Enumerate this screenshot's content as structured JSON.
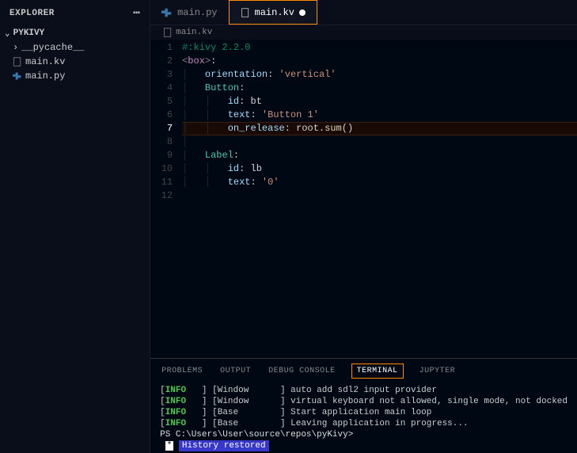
{
  "sidebar": {
    "title": "EXPLORER",
    "project": "PYKIVY",
    "items": [
      {
        "label": "__pycache__",
        "type": "folder"
      },
      {
        "label": "main.kv",
        "type": "file-kv"
      },
      {
        "label": "main.py",
        "type": "file-py"
      }
    ]
  },
  "tabs": [
    {
      "label": "main.py",
      "icon": "py",
      "active": false,
      "dirty": false
    },
    {
      "label": "main.kv",
      "icon": "kv",
      "active": true,
      "dirty": true
    }
  ],
  "breadcrumb": "main.kv",
  "code": {
    "activeLine": 7,
    "lines": [
      {
        "n": 1,
        "segments": [
          {
            "t": "#:kivy 2.2.0",
            "c": "tok-comment"
          }
        ]
      },
      {
        "n": 2,
        "segments": [
          {
            "t": "<",
            "c": "tok-ang"
          },
          {
            "t": "box",
            "c": "tok-tag"
          },
          {
            "t": ">",
            "c": "tok-ang"
          },
          {
            "t": ":",
            "c": "tok-paren"
          }
        ]
      },
      {
        "n": 3,
        "segments": [
          {
            "t": "│   ",
            "c": "indent-guide"
          },
          {
            "t": "orientation",
            "c": "tok-ident"
          },
          {
            "t": ": ",
            "c": "tok-paren"
          },
          {
            "t": "'vertical'",
            "c": "tok-string"
          }
        ]
      },
      {
        "n": 4,
        "segments": [
          {
            "t": "│   ",
            "c": "indent-guide"
          },
          {
            "t": "Button",
            "c": "tok-prop"
          },
          {
            "t": ":",
            "c": "tok-paren"
          }
        ]
      },
      {
        "n": 5,
        "segments": [
          {
            "t": "│   │   ",
            "c": "indent-guide"
          },
          {
            "t": "id",
            "c": "tok-ident"
          },
          {
            "t": ": bt",
            "c": "tok-paren"
          }
        ]
      },
      {
        "n": 6,
        "segments": [
          {
            "t": "│   │   ",
            "c": "indent-guide"
          },
          {
            "t": "text",
            "c": "tok-ident"
          },
          {
            "t": ": ",
            "c": "tok-paren"
          },
          {
            "t": "'Button 1'",
            "c": "tok-string"
          }
        ]
      },
      {
        "n": 7,
        "hl": true,
        "segments": [
          {
            "t": "│   │   ",
            "c": "indent-guide"
          },
          {
            "t": "on_release",
            "c": "tok-ident"
          },
          {
            "t": ": root.",
            "c": "tok-paren"
          },
          {
            "t": "sum",
            "c": "tok-func"
          },
          {
            "t": "()",
            "c": "tok-paren"
          }
        ]
      },
      {
        "n": 8,
        "segments": [
          {
            "t": "│",
            "c": "indent-guide"
          }
        ]
      },
      {
        "n": 9,
        "segments": [
          {
            "t": "│   ",
            "c": "indent-guide"
          },
          {
            "t": "Label",
            "c": "tok-prop"
          },
          {
            "t": ":",
            "c": "tok-paren"
          }
        ]
      },
      {
        "n": 10,
        "segments": [
          {
            "t": "│   │   ",
            "c": "indent-guide"
          },
          {
            "t": "id",
            "c": "tok-ident"
          },
          {
            "t": ": lb",
            "c": "tok-paren"
          }
        ]
      },
      {
        "n": 11,
        "segments": [
          {
            "t": "│   │   ",
            "c": "indent-guide"
          },
          {
            "t": "text",
            "c": "tok-ident"
          },
          {
            "t": ": ",
            "c": "tok-paren"
          },
          {
            "t": "'0'",
            "c": "tok-string"
          }
        ]
      },
      {
        "n": 12,
        "segments": []
      }
    ]
  },
  "panel": {
    "tabs": [
      "PROBLEMS",
      "OUTPUT",
      "DEBUG CONSOLE",
      "TERMINAL",
      "JUPYTER"
    ],
    "activeTab": "TERMINAL",
    "terminal": {
      "logs": [
        {
          "level": "INFO",
          "component": "Window",
          "msg": "auto add sdl2 input provider"
        },
        {
          "level": "INFO",
          "component": "Window",
          "msg": "virtual keyboard not allowed, single mode, not docked"
        },
        {
          "level": "INFO",
          "component": "Base",
          "msg": "Start application main loop"
        },
        {
          "level": "INFO",
          "component": "Base",
          "msg": "Leaving application in progress..."
        }
      ],
      "prompt": "PS C:\\Users\\User\\source\\repos\\pyKivy>",
      "history": "History restored"
    }
  }
}
